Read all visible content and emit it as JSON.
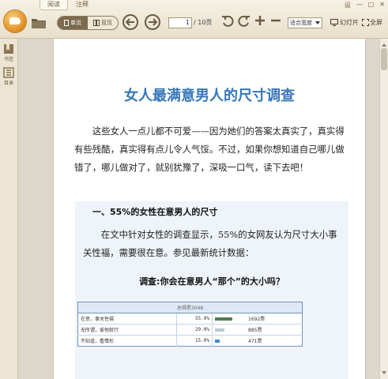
{
  "app": {
    "tabs": [
      {
        "label": "阅读"
      },
      {
        "label": "注释"
      }
    ],
    "window_controls": {
      "settings": "设",
      "minimize": "—",
      "restore": "□",
      "close": "✕"
    }
  },
  "toolbar": {
    "single_page_label": "单页",
    "double_page_label": "双页",
    "page_current": "1",
    "page_total": "/ 10页",
    "zoom_mode": "适合宽度",
    "slideshow_label": "幻灯片",
    "fullscreen_label": "全屏"
  },
  "sidebar": {
    "items": [
      {
        "label": "书签"
      },
      {
        "label": "目录"
      }
    ]
  },
  "document": {
    "title": "女人最满意男人的尺寸调查",
    "intro": "这些女人一点儿都不可爱——因为她们的答案太真实了，真实得有些残酷，真实得有点儿令人气馁。不过，如果你想知道自己哪儿做错了，哪儿做对了，就别犹豫了，深吸一口气，读下去吧！",
    "section1_heading": "一、55%的女性在意男人的尺寸",
    "section1_body": "在文中针对女性的调查显示，55%的女网友认为尺寸大小事关性福，需要很在意。参见最新统计数据：",
    "poll": {
      "title": "调查:你会在意男人“那个”的大小吗？",
      "total_label": "总得票3048",
      "options": [
        {
          "label": "在意，事关性福",
          "percent": "55.0%",
          "votes_text": "1692票",
          "fraction": 0.55,
          "color": "#4f7d57"
        },
        {
          "label": "无所谓，爱他就行",
          "percent": "29.0%",
          "votes_text": "885票",
          "fraction": 0.29,
          "color": "#b7c9dc"
        },
        {
          "label": "不知道，看情形",
          "percent": "15.0%",
          "votes_text": "471票",
          "fraction": 0.15,
          "color": "#3a8ec9"
        }
      ]
    }
  }
}
